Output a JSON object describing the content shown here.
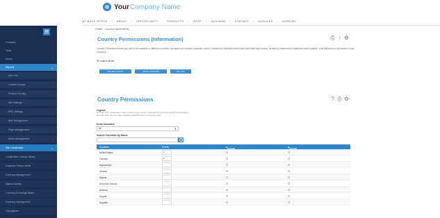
{
  "header": {
    "logo_your": "Your",
    "logo_company": "Company Name",
    "nav": [
      "MY BACK OFFICE",
      "ABOUT",
      "OPPORTUNITY",
      "PRODUCTS",
      "SHOP",
      "JOIN NOW",
      "CONTACT",
      "MODULES",
      "SUPPORT"
    ]
  },
  "sidebar": {
    "items": [
      {
        "label": "Company"
      },
      {
        "label": "Tools"
      },
      {
        "label": "Admin"
      },
      {
        "label": "Reports"
      },
      {
        "label": "Auto Info"
      },
      {
        "label": "Contact Groups"
      },
      {
        "label": "Product Country"
      },
      {
        "label": "Site Settings"
      },
      {
        "label": "PRC Settings"
      },
      {
        "label": "Item Management"
      },
      {
        "label": "Page Management"
      },
      {
        "label": "Menu Management"
      },
      {
        "label": "Site Localization"
      },
      {
        "label": "Localization Lookup Library"
      },
      {
        "label": "Customer Return Order"
      },
      {
        "label": "Currency Management"
      },
      {
        "label": "Adjust Country"
      },
      {
        "label": "Currency Exchange Rates"
      },
      {
        "label": "Currency Management"
      },
      {
        "label": "Translations"
      }
    ]
  },
  "main": {
    "breadcrumb": "Home > Country Applicability",
    "title": "Country Permissions (Information)",
    "description": "Country Permissions allow you rule to be viewable in different countries, but again you receive complete control. Choose the countries that should have treat only access, be able to placement or distribute tasks together. It all depends on the needs of your company.",
    "learn_more": "Learn More",
    "buttons": [
      "ADD NEW COUNTRY",
      "IMPORT COUNTRIES",
      "BULK EDIT"
    ],
    "section_title": "Country Permissions",
    "legend_title": "Legend",
    "legend_lines": [
      "Exclude from Registration: when ticked is the country Required for the Permitted for Registration",
      "Exclude from Access: when ticked is Restricted for Access from site"
    ],
    "from_countries_label": "From Countries",
    "from_countries_value": "All",
    "search_label": "Search Countries by Name",
    "table": {
      "headers": [
        "Countries",
        "Priority",
        "Exclude Registration",
        "Exclude Access"
      ],
      "rows": [
        {
          "name": "United States",
          "priority": "1"
        },
        {
          "name": "Canada",
          "priority": "2"
        },
        {
          "name": "Afghanistan",
          "priority": ""
        },
        {
          "name": "Albania",
          "priority": ""
        },
        {
          "name": "Algeria",
          "priority": ""
        },
        {
          "name": "American Samoa",
          "priority": ""
        },
        {
          "name": "Andorra",
          "priority": ""
        },
        {
          "name": "Angola",
          "priority": ""
        },
        {
          "name": "Anguilla",
          "priority": ""
        }
      ]
    }
  }
}
